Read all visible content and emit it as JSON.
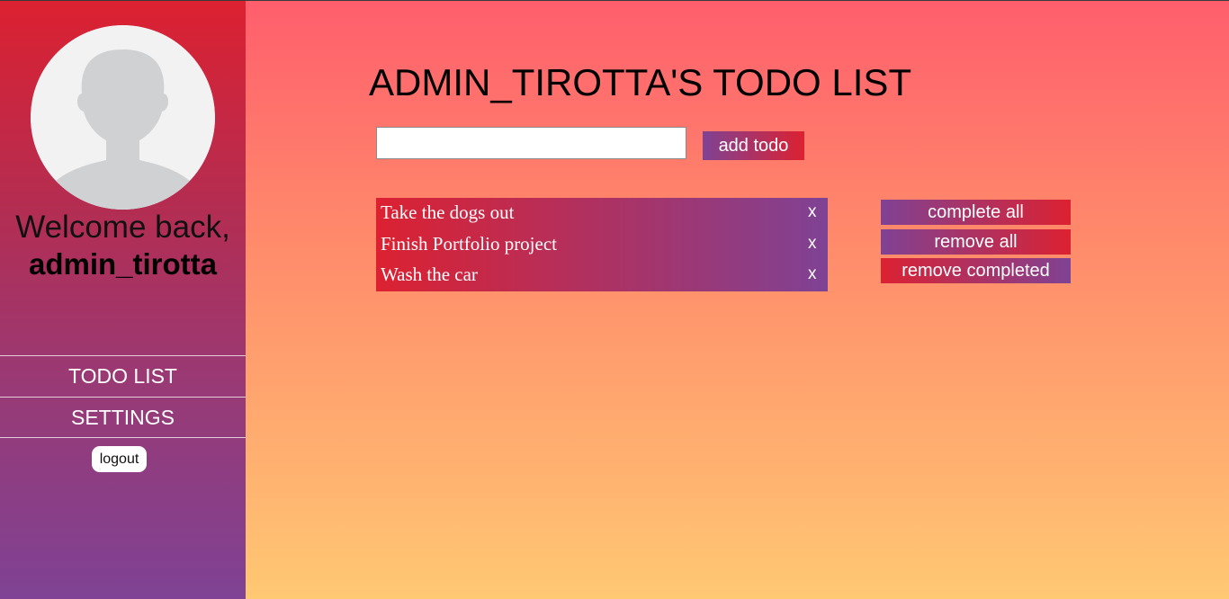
{
  "sidebar": {
    "welcome": "Welcome back,",
    "username": "admin_tirotta",
    "nav": [
      "TODO LIST",
      "SETTINGS"
    ],
    "logout": "logout"
  },
  "main": {
    "title": "ADMIN_TIROTTA'S TODO LIST",
    "input": {
      "value": "",
      "placeholder": ""
    },
    "add_button": "add todo",
    "todos": [
      {
        "text": "Take the dogs out",
        "remove": "x"
      },
      {
        "text": "Finish Portfolio project",
        "remove": "x"
      },
      {
        "text": "Wash the car",
        "remove": "x"
      }
    ],
    "actions": [
      "complete all",
      "remove all",
      "remove completed"
    ]
  },
  "colors": {
    "accent_red": "#dc2131",
    "accent_purple": "#7f4294",
    "bg_top": "#ff5e6c",
    "bg_bottom": "#ffc873"
  },
  "icons": {
    "avatar": "user-placeholder-icon",
    "remove": "close-x"
  }
}
